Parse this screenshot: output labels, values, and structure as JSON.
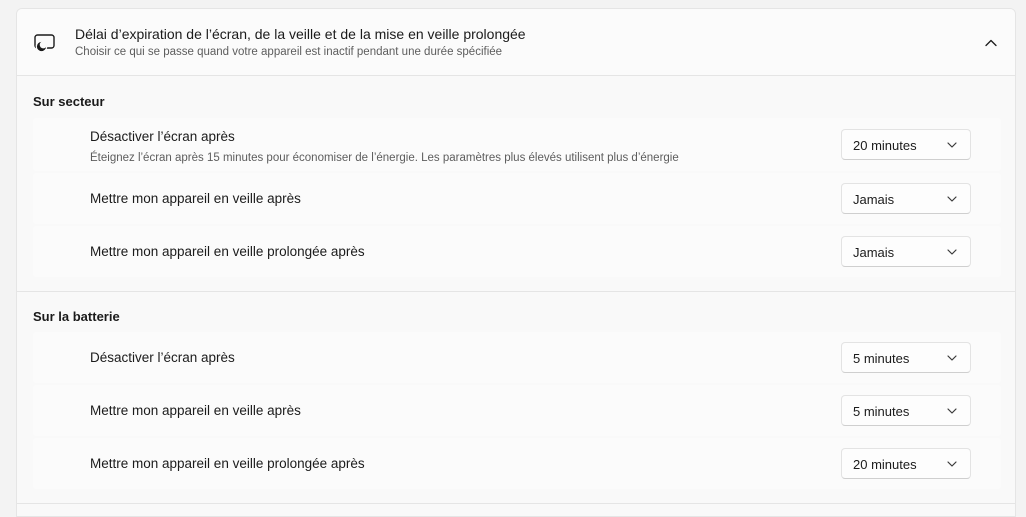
{
  "header": {
    "title": "Délai d’expiration de l’écran, de la veille et de la mise en veille prolongée",
    "subtitle": "Choisir ce qui se passe quand votre appareil est inactif pendant une durée spécifiée",
    "icon": "screen-sleep-icon",
    "collapse_icon": "chevron-up-icon"
  },
  "sections": [
    {
      "title": "Sur secteur",
      "rows": [
        {
          "label": "Désactiver l’écran après",
          "description": "Éteignez l’écran après 15 minutes pour économiser de l’énergie. Les paramètres plus élevés utilisent plus d’énergie",
          "value": "20 minutes"
        },
        {
          "label": "Mettre mon appareil en veille après",
          "value": "Jamais"
        },
        {
          "label": "Mettre mon appareil en veille prolongée après",
          "value": "Jamais"
        }
      ]
    },
    {
      "title": "Sur la batterie",
      "rows": [
        {
          "label": "Désactiver l’écran après",
          "value": "5 minutes"
        },
        {
          "label": "Mettre mon appareil en veille après",
          "value": "5 minutes"
        },
        {
          "label": "Mettre mon appareil en veille prolongée après",
          "value": "20 minutes"
        }
      ]
    }
  ],
  "colors": {
    "background": "#f3f3f3",
    "card": "#f9f9f9",
    "row": "#fbfbfb",
    "border": "#e5e5e5",
    "text": "#1b1b1b",
    "secondary_text": "#5d5d5d"
  }
}
